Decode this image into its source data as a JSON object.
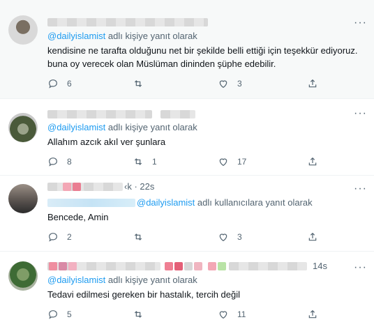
{
  "more_label": "···",
  "tweets": [
    {
      "reply_prefix": "@dailyislamist",
      "reply_suffix": " adlı kişiye yanıt olarak",
      "text": "kendisine ne tarafta olduğunu net bir şekilde belli ettiği için teşekkür ediyoruz. buna oy verecek olan Müslüman dininden şüphe edebilir.",
      "replies": "6",
      "retweets": "",
      "likes": "3"
    },
    {
      "reply_prefix": "@dailyislamist",
      "reply_suffix": " adlı kişiye yanıt olarak",
      "text": "Allahım azcık akıl ver şunlara",
      "replies": "8",
      "retweets": "1",
      "likes": "17"
    },
    {
      "handle_tail": "‹k · 22s",
      "reply_prefix": "@dailyislamist",
      "reply_suffix": " adlı kullanıcılara yanıt olarak",
      "text": "Bencede, Amin",
      "replies": "2",
      "retweets": "",
      "likes": "3"
    },
    {
      "time": "14s",
      "reply_prefix": "@dailyislamist",
      "reply_suffix": " adlı kişiye yanıt olarak",
      "text": "Tedavi edilmesi gereken bir hastalık, tercih değil",
      "replies": "5",
      "retweets": "",
      "likes": "11"
    }
  ],
  "icons": [
    "reply-icon",
    "retweet-icon",
    "like-icon",
    "share-icon"
  ]
}
